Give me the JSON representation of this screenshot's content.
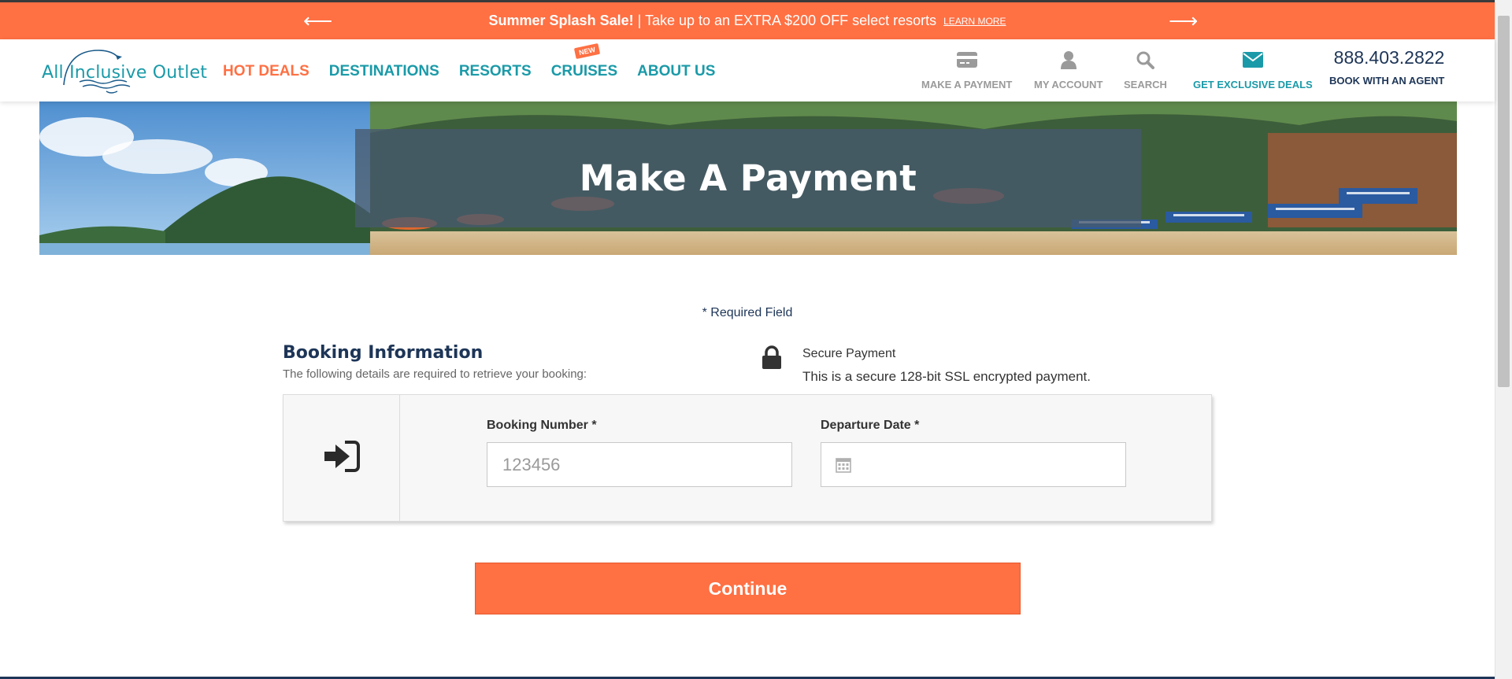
{
  "promo": {
    "prev_arrow": "⟵",
    "next_arrow": "⟶",
    "headline": "Summer Splash Sale!",
    "message": " | Take up to an EXTRA $200 OFF select resorts",
    "learn_more": "LEARN MORE"
  },
  "header": {
    "logo_text": "All Inclusive Outlet",
    "nav": {
      "hot_deals": "HOT DEALS",
      "destinations": "DESTINATIONS",
      "resorts": "RESORTS",
      "cruises": "CRUISES",
      "cruises_badge": "NEW",
      "about_us": "ABOUT US"
    },
    "utilities": {
      "make_payment": "MAKE A PAYMENT",
      "my_account": "MY ACCOUNT",
      "search": "SEARCH",
      "exclusive_deals": "GET EXCLUSIVE DEALS"
    },
    "phone": "888.403.2822",
    "book_agent": "BOOK WITH AN AGENT"
  },
  "hero": {
    "title": "Make A Payment"
  },
  "form": {
    "required_note": "* Required Field",
    "booking_heading": "Booking Information",
    "booking_subheading": "The following details are required to retrieve your booking:",
    "secure_heading": "Secure Payment",
    "secure_text": "This is a secure 128-bit SSL encrypted payment.",
    "booking_number_label": "Booking Number *",
    "booking_number_placeholder": "123456",
    "booking_number_value": "",
    "departure_date_label": "Departure Date *",
    "departure_date_value": "",
    "continue_label": "Continue"
  },
  "colors": {
    "accent_orange": "#ff7043",
    "brand_teal": "#1a9aa8",
    "navy": "#1d3557"
  }
}
